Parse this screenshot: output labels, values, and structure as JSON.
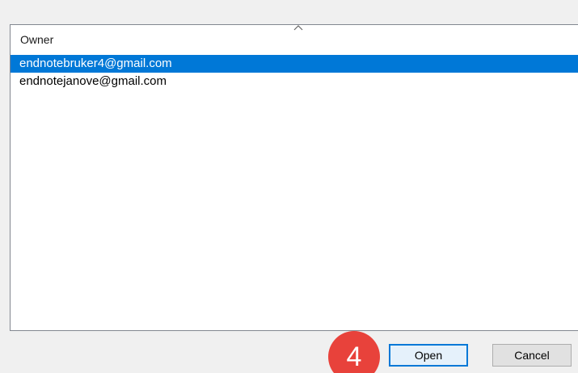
{
  "list": {
    "column_header": "Owner",
    "sort_indicator": "^",
    "rows": [
      {
        "owner": "endnotebruker4@gmail.com",
        "selected": true
      },
      {
        "owner": "endnotejanove@gmail.com",
        "selected": false
      }
    ]
  },
  "step_badge": "4",
  "buttons": {
    "open_label": "Open",
    "cancel_label": "Cancel"
  },
  "colors": {
    "selection": "#0078d7",
    "badge": "#e8423b",
    "dialog_bg": "#f0f0f0"
  },
  "icons": {
    "sort": "chevron-up-icon"
  }
}
